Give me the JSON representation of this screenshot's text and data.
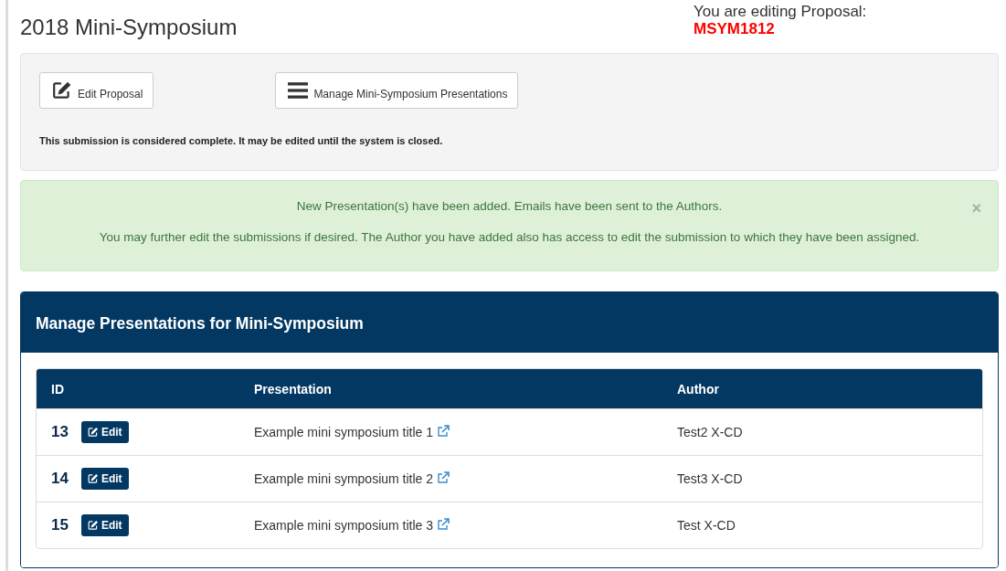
{
  "page_title": "2018 Mini-Symposium",
  "editing": {
    "label": "You are editing Proposal:",
    "proposal_id": "MSYM1812"
  },
  "toolbar": {
    "buttons": [
      {
        "kind": "edit",
        "label": "Edit Proposal"
      },
      {
        "kind": "list",
        "label": "Manage Mini-Symposium Presentations"
      }
    ],
    "note": "This submission is considered complete. It may be edited until the system is closed."
  },
  "alert": {
    "lines": [
      "New Presentation(s) have been added. Emails have been sent to the Authors.",
      "You may further edit the submissions if desired. The Author you have added also has access to edit the submission to which they have been assigned."
    ],
    "close": "×"
  },
  "panel": {
    "title": "Manage Presentations for Mini-Symposium",
    "table": {
      "columns": [
        "ID",
        "Presentation",
        "Author"
      ],
      "rows": [
        {
          "id": "13",
          "edit": "Edit",
          "presentation": "Example mini symposium title 1",
          "author": "Test2 X-CD"
        },
        {
          "id": "14",
          "edit": "Edit",
          "presentation": "Example mini symposium title 2",
          "author": "Test3 X-CD"
        },
        {
          "id": "15",
          "edit": "Edit",
          "presentation": "Example mini symposium title 3",
          "author": "Test X-CD"
        }
      ]
    }
  }
}
